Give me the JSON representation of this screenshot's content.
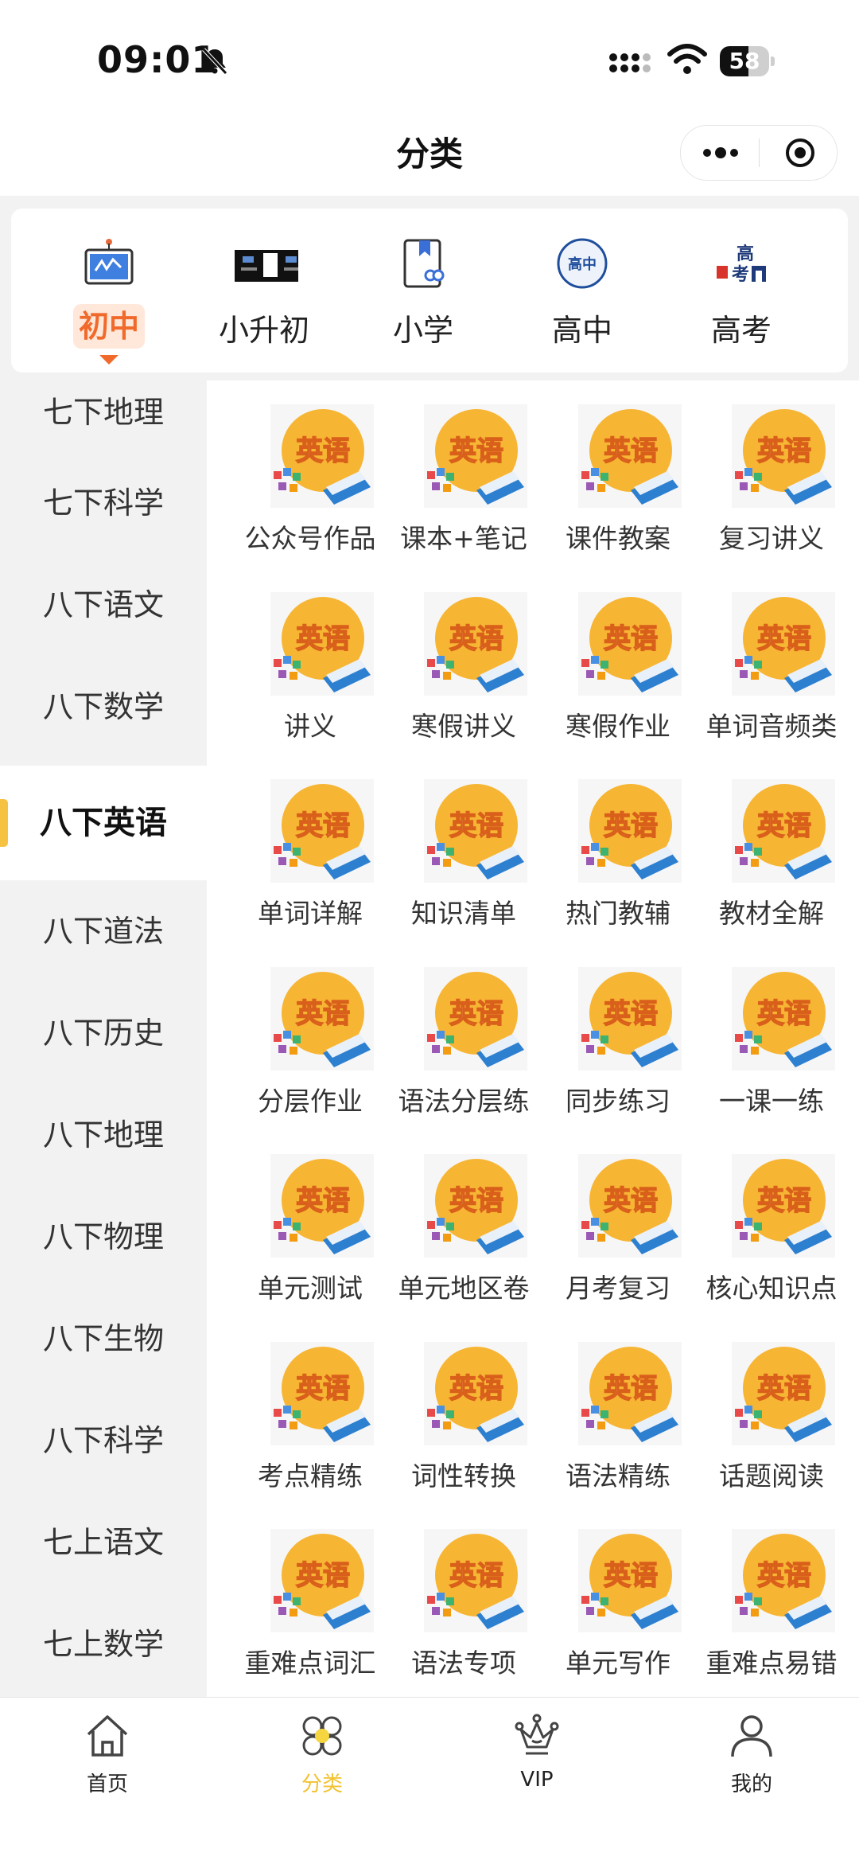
{
  "status_bar": {
    "time": "09:01",
    "battery": "58",
    "battery_level": 0.58
  },
  "nav": {
    "title": "分类"
  },
  "grades": [
    {
      "label": "初中",
      "icon": "blackboard-icon",
      "active": true
    },
    {
      "label": "小升初",
      "icon": "poster-icon",
      "active": false
    },
    {
      "label": "小学",
      "icon": "book-link-icon",
      "active": false
    },
    {
      "label": "高中",
      "icon": "high-school-badge-icon",
      "active": false,
      "badge": "高中"
    },
    {
      "label": "高考",
      "icon": "gaokao-building-icon",
      "active": false,
      "badge": "高考"
    }
  ],
  "sidebar": {
    "items": [
      {
        "label": "七下地理"
      },
      {
        "label": "七下科学"
      },
      {
        "label": "八下语文"
      },
      {
        "label": "八下数学"
      },
      {
        "label": "八下英语",
        "active": true
      },
      {
        "label": "八下道法"
      },
      {
        "label": "八下历史"
      },
      {
        "label": "八下地理"
      },
      {
        "label": "八下物理"
      },
      {
        "label": "八下生物"
      },
      {
        "label": "八下科学"
      },
      {
        "label": "七上语文"
      },
      {
        "label": "七上数学"
      }
    ]
  },
  "thumb_text": "英语",
  "categories": [
    "公众号作品",
    "课本+笔记",
    "课件教案",
    "复习讲义",
    "讲义",
    "寒假讲义",
    "寒假作业",
    "单词音频类",
    "单词详解",
    "知识清单",
    "热门教辅",
    "教材全解",
    "分层作业",
    "语法分层练",
    "同步练习",
    "一课一练",
    "单元测试",
    "单元地区卷",
    "月考复习",
    "核心知识点",
    "考点精练",
    "词性转换",
    "语法精练",
    "话题阅读",
    "重难点词汇",
    "语法专项",
    "单元写作",
    "重难点易错"
  ],
  "tabbar": [
    {
      "label": "首页",
      "icon": "home-icon",
      "active": false
    },
    {
      "label": "分类",
      "icon": "category-icon",
      "active": true
    },
    {
      "label": "VIP",
      "icon": "crown-icon",
      "active": false
    },
    {
      "label": "我的",
      "icon": "profile-icon",
      "active": false
    }
  ],
  "colors": {
    "accent_orange": "#f06a2c",
    "accent_yellow": "#f2c230",
    "thumb_circle": "#f7b534"
  }
}
